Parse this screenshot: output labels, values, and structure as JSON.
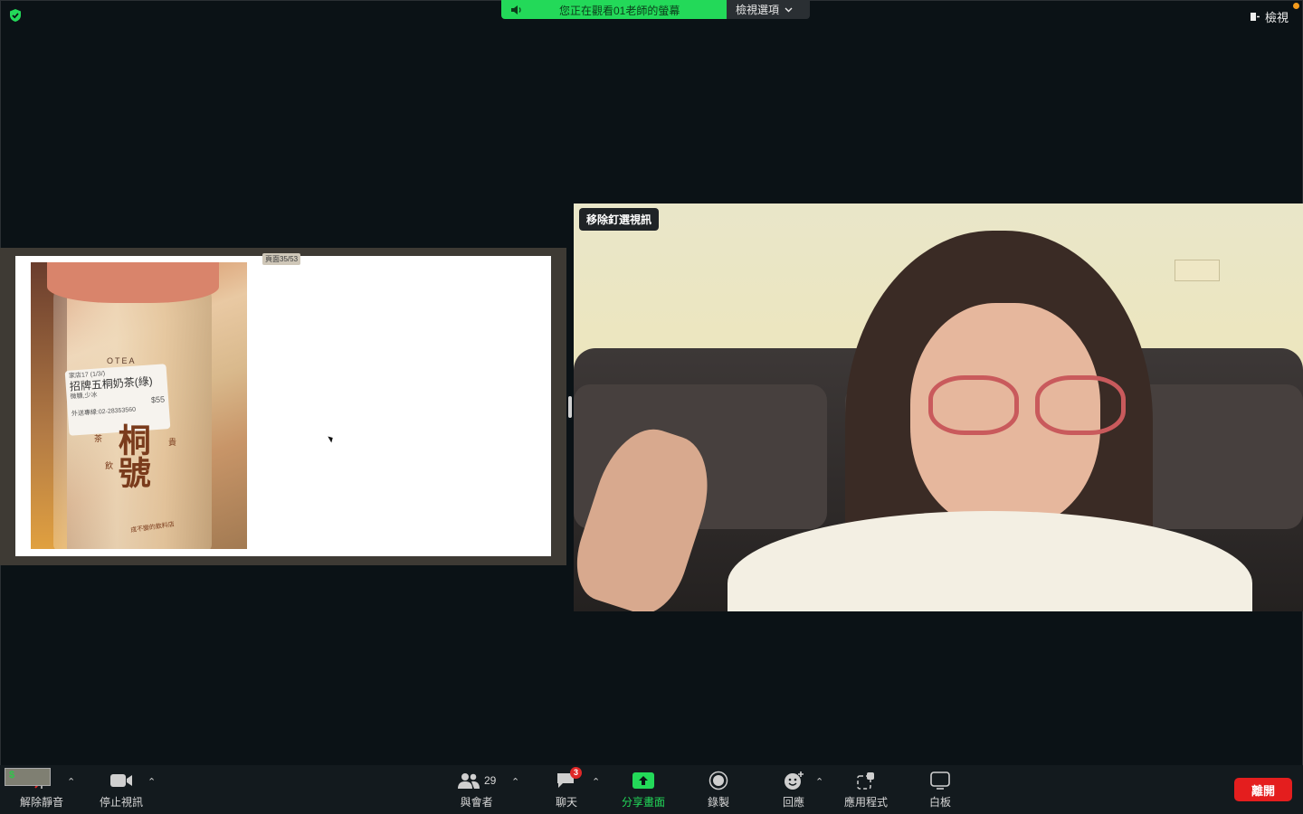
{
  "banner": {
    "viewing_text": "您正在觀看01老師的螢幕",
    "options_label": "檢視選項"
  },
  "top_right": {
    "view_label": "檢視"
  },
  "shared_screen": {
    "page_indicator": "頁面35/53",
    "photo": {
      "sticker_store": "家店17",
      "sticker_date": "(1/3/)",
      "sticker_item": "招牌五桐奶茶(綠)",
      "sticker_options": "微糖,少冰",
      "sticker_price": "$55",
      "sticker_phone": "外送專線:02-28353560",
      "cup_brand": "桐號",
      "cup_side_left": "茶",
      "cup_side_right": "貴",
      "cup_side_bottom": "飲",
      "cup_slogan": "成不變的飲料店",
      "cup_top": "OTEA"
    }
  },
  "video": {
    "pin_label": "移除釘選視訊"
  },
  "self_view": {
    "symbol": "$"
  },
  "toolbar": {
    "unmute_label": "解除靜音",
    "stop_video_label": "停止視訊",
    "participants_label": "與會者",
    "participants_count": "29",
    "chat_label": "聊天",
    "chat_badge": "3",
    "share_label": "分享畫面",
    "record_label": "錄製",
    "reactions_label": "回應",
    "apps_label": "應用程式",
    "whiteboard_label": "白板",
    "leave_label": "離開"
  },
  "colors": {
    "background": "#0b1216",
    "banner_green": "#23d959",
    "share_green": "#23d959",
    "leave_red": "#e41e1e",
    "badge_red": "#e02828"
  },
  "icons": [
    "shield-check-icon",
    "speaker-icon",
    "chevron-down-icon",
    "view-icon",
    "mic-muted-icon",
    "video-camera-icon",
    "participants-icon",
    "chat-icon",
    "share-screen-icon",
    "record-icon",
    "reactions-icon",
    "apps-icon",
    "whiteboard-icon",
    "caret-up-icon"
  ]
}
